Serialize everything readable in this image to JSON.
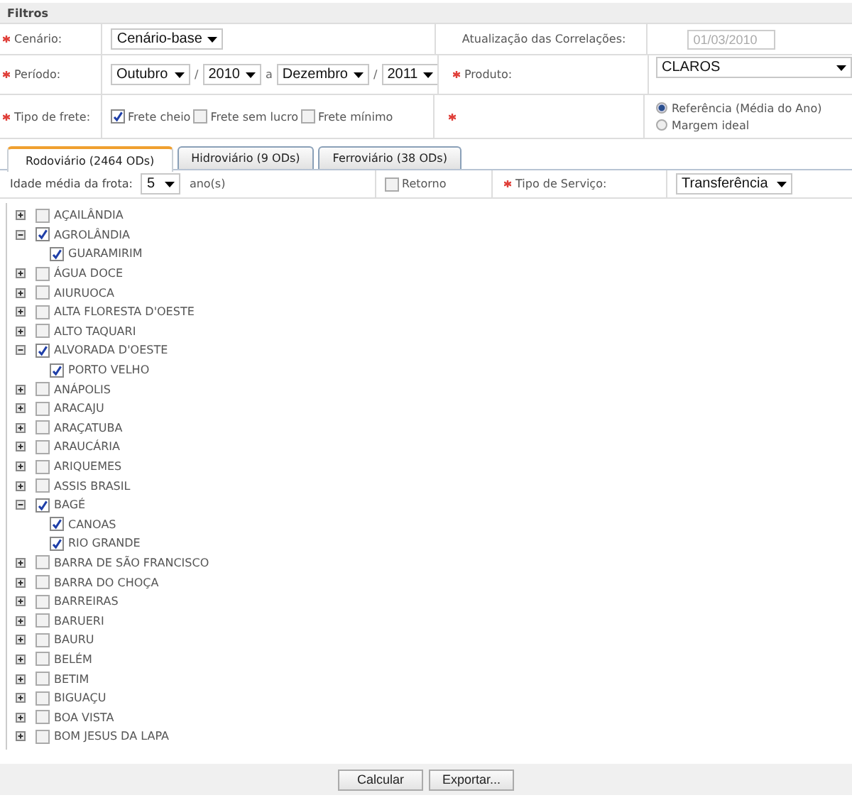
{
  "panel_title": "Filtros",
  "scenario": {
    "label": "Cenário:",
    "required": true,
    "value": "Cenário-base"
  },
  "correlation_update": {
    "label": "Atualização das Correlações:",
    "required": false,
    "value": "01/03/2010",
    "disabled": true
  },
  "period": {
    "label": "Período:",
    "required": true,
    "from_month": "Outubro",
    "from_sep": "/",
    "from_year": "2010",
    "between": "a",
    "to_month": "Dezembro",
    "to_sep": "/",
    "to_year": "2011"
  },
  "product": {
    "label": "Produto:",
    "required": true,
    "value": "CLAROS"
  },
  "freight_type": {
    "label": "Tipo de frete:",
    "required": true,
    "options": [
      {
        "label": "Frete cheio",
        "checked": true
      },
      {
        "label": "Frete sem lucro",
        "checked": false
      },
      {
        "label": "Frete mínimo",
        "checked": false
      }
    ]
  },
  "margin": {
    "required": true,
    "options": [
      {
        "label": "Referência (Média do Ano)",
        "selected": true
      },
      {
        "label": "Margem ideal",
        "selected": false
      }
    ]
  },
  "tabs": [
    {
      "label": "Rodoviário (2464 ODs)",
      "selected": true
    },
    {
      "label": "Hidroviário (9 ODs)",
      "selected": false
    },
    {
      "label": "Ferroviário (38 ODs)",
      "selected": false
    }
  ],
  "fleet_age": {
    "label": "Idade média da frota:",
    "value": "5",
    "unit": "ano(s)"
  },
  "return_trip": {
    "label": "Retorno",
    "checked": false
  },
  "service_type": {
    "label": "Tipo de Serviço:",
    "required": true,
    "value": "Transferência"
  },
  "tree": [
    {
      "label": "AÇAILÂNDIA",
      "checked": false,
      "expanded": false
    },
    {
      "label": "AGROLÂNDIA",
      "checked": true,
      "expanded": true,
      "children": [
        {
          "label": "GUARAMIRIM",
          "checked": true
        }
      ]
    },
    {
      "label": "ÁGUA DOCE",
      "checked": false,
      "expanded": false
    },
    {
      "label": "AIURUOCA",
      "checked": false,
      "expanded": false
    },
    {
      "label": "ALTA FLORESTA D'OESTE",
      "checked": false,
      "expanded": false
    },
    {
      "label": "ALTO TAQUARI",
      "checked": false,
      "expanded": false
    },
    {
      "label": "ALVORADA D'OESTE",
      "checked": true,
      "expanded": true,
      "children": [
        {
          "label": "PORTO VELHO",
          "checked": true
        }
      ]
    },
    {
      "label": "ANÁPOLIS",
      "checked": false,
      "expanded": false
    },
    {
      "label": "ARACAJU",
      "checked": false,
      "expanded": false
    },
    {
      "label": "ARAÇATUBA",
      "checked": false,
      "expanded": false
    },
    {
      "label": "ARAUCÁRIA",
      "checked": false,
      "expanded": false
    },
    {
      "label": "ARIQUEMES",
      "checked": false,
      "expanded": false
    },
    {
      "label": "ASSIS BRASIL",
      "checked": false,
      "expanded": false
    },
    {
      "label": "BAGÉ",
      "checked": true,
      "expanded": true,
      "children": [
        {
          "label": "CANOAS",
          "checked": true
        },
        {
          "label": "RIO GRANDE",
          "checked": true
        }
      ]
    },
    {
      "label": "BARRA DE SÃO FRANCISCO",
      "checked": false,
      "expanded": false
    },
    {
      "label": "BARRA DO CHOÇA",
      "checked": false,
      "expanded": false
    },
    {
      "label": "BARREIRAS",
      "checked": false,
      "expanded": false
    },
    {
      "label": "BARUERI",
      "checked": false,
      "expanded": false
    },
    {
      "label": "BAURU",
      "checked": false,
      "expanded": false
    },
    {
      "label": "BELÉM",
      "checked": false,
      "expanded": false
    },
    {
      "label": "BETIM",
      "checked": false,
      "expanded": false
    },
    {
      "label": "BIGUAÇU",
      "checked": false,
      "expanded": false
    },
    {
      "label": "BOA VISTA",
      "checked": false,
      "expanded": false
    },
    {
      "label": "BOM JESUS DA LAPA",
      "checked": false,
      "expanded": false
    }
  ],
  "buttons": [
    "Calcular",
    "Exportar..."
  ]
}
